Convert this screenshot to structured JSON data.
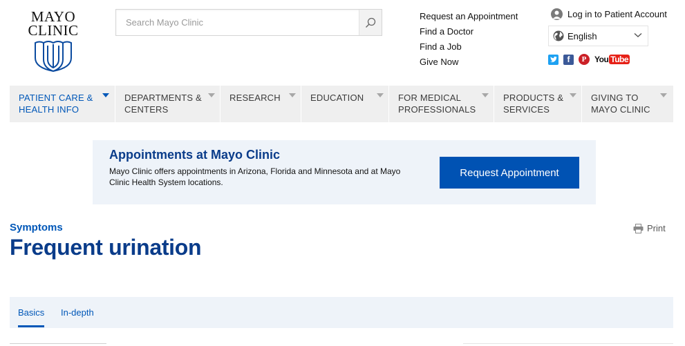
{
  "header": {
    "logo_lines": [
      "MAYO",
      "CLINIC"
    ],
    "search": {
      "placeholder": "Search Mayo Clinic",
      "icon": "search-icon"
    },
    "quick_links": [
      "Request an Appointment",
      "Find a Doctor",
      "Find a Job",
      "Give Now"
    ],
    "account_label": "Log in to Patient Account",
    "language": {
      "selected": "English",
      "icon": "globe-icon"
    },
    "social": {
      "facebook_glyph": "f",
      "pinterest_glyph": "P",
      "youtube_you": "You",
      "youtube_tube": "Tube"
    }
  },
  "nav": {
    "items": [
      {
        "label": "PATIENT CARE &\nHEALTH INFO",
        "active": true
      },
      {
        "label": "DEPARTMENTS &\nCENTERS",
        "active": false
      },
      {
        "label": "RESEARCH",
        "active": false
      },
      {
        "label": "EDUCATION",
        "active": false
      },
      {
        "label": "FOR MEDICAL\nPROFESSIONALS",
        "active": false
      },
      {
        "label": "PRODUCTS &\nSERVICES",
        "active": false
      },
      {
        "label": "GIVING TO\nMAYO CLINIC",
        "active": false
      }
    ]
  },
  "appointments": {
    "title": "Appointments at Mayo Clinic",
    "text": "Mayo Clinic offers appointments in Arizona, Florida and Minnesota and at Mayo Clinic Health System locations.",
    "button_label": "Request Appointment"
  },
  "page": {
    "section_label": "Symptoms",
    "title": "Frequent urination",
    "print_label": "Print"
  },
  "tabs": {
    "items": [
      "Basics",
      "In-depth"
    ],
    "active_index": 0
  },
  "colors": {
    "brand_blue": "#0057b8",
    "title_blue": "#0a3c8a",
    "button_blue": "#0052b3",
    "nav_bg": "#efefef",
    "banner_bg": "#eef3f9"
  }
}
